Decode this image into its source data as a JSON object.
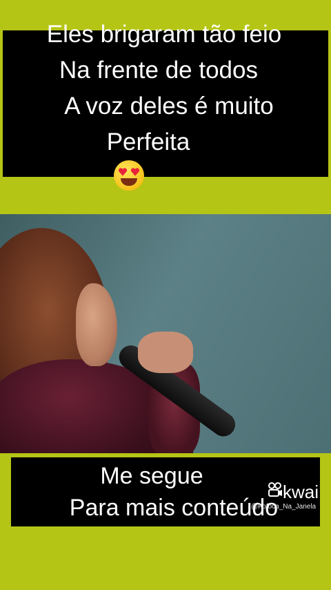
{
  "caption_top": {
    "line1": "Eles brigaram tão feio",
    "line2": "Na frente de todos",
    "line3": "A voz deles é muito",
    "line4": "Perfeita",
    "emoji": "heart-eyes-emoji"
  },
  "caption_bottom": {
    "line1": "Me segue",
    "line2": "Para mais conteúdo"
  },
  "watermark": {
    "brand": "kwai",
    "handle": "@Fofoca_Na_Janela",
    "icon": "kwai-logo-icon"
  },
  "colors": {
    "background": "#b5c516",
    "caption_bg": "#000000",
    "caption_text": "#ffffff"
  }
}
